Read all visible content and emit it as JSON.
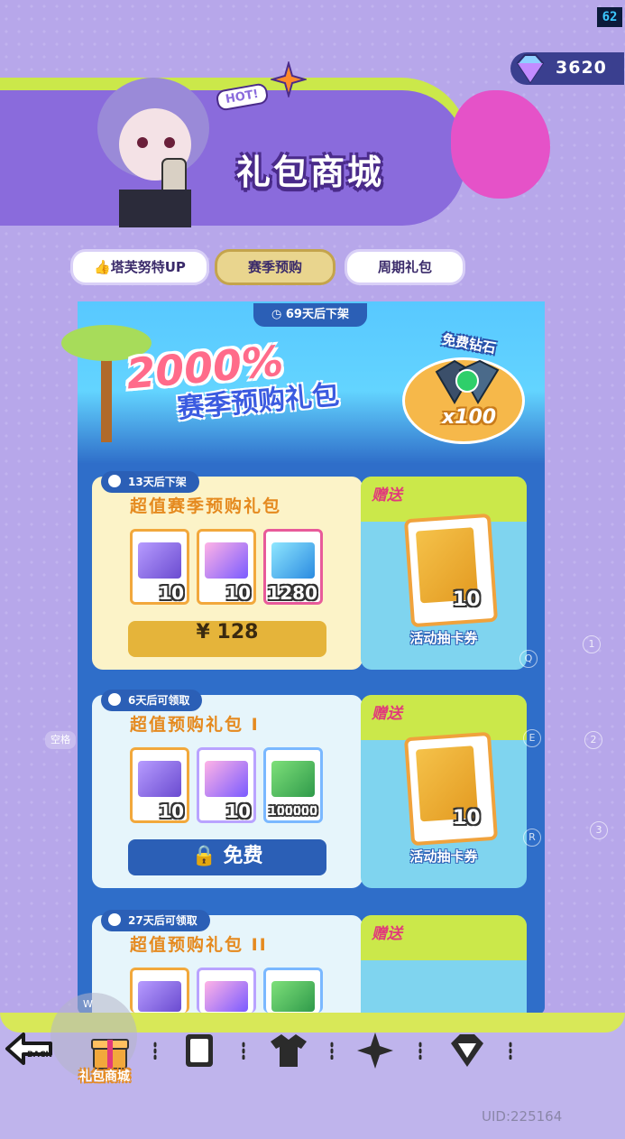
{
  "hud": {
    "fps": "62",
    "gem_count": "3620"
  },
  "banner": {
    "hot": "HOT!",
    "title": "礼包商城"
  },
  "tabs": [
    {
      "label": "塔芙努特UP",
      "active": false
    },
    {
      "label": "赛季预购",
      "active": true
    },
    {
      "label": "周期礼包",
      "active": false
    }
  ],
  "hero": {
    "timer": "69天后下架",
    "headline": "2000%",
    "subtitle": "赛季预购礼包",
    "free_gem_label": "免费钻石",
    "free_gem_qty": "x100"
  },
  "packages": [
    {
      "timer": "13天后下架",
      "title": "超值赛季预购礼包",
      "items": [
        {
          "icon": "purple-ticket-icon",
          "qty": "10"
        },
        {
          "icon": "holo-ticket-icon",
          "qty": "10"
        },
        {
          "icon": "diamond-icon",
          "qty": "1280"
        }
      ],
      "button": "¥ 128",
      "gift_label": "赠送",
      "gift_qty": "10",
      "gift_name": "活动抽卡券"
    },
    {
      "timer": "6天后可领取",
      "title": "超值预购礼包 I",
      "items": [
        {
          "icon": "purple-ticket-icon",
          "qty": "10"
        },
        {
          "icon": "holo-ticket-icon",
          "qty": "10"
        },
        {
          "icon": "cash-icon",
          "qty": "100000"
        }
      ],
      "button": "免费",
      "gift_label": "赠送",
      "gift_qty": "10",
      "gift_name": "活动抽卡券"
    },
    {
      "timer": "27天后可领取",
      "title": "超值预购礼包 II",
      "gift_label": "赠送"
    }
  ],
  "side_hints": {
    "left": "空格",
    "keys": [
      "Q",
      "E",
      "R"
    ],
    "nums": [
      "1",
      "2",
      "3"
    ],
    "w": "W"
  },
  "bottom_nav": {
    "back": "BACK",
    "active_label": "礼包商城"
  },
  "footer": {
    "uid": "UID:225164"
  }
}
